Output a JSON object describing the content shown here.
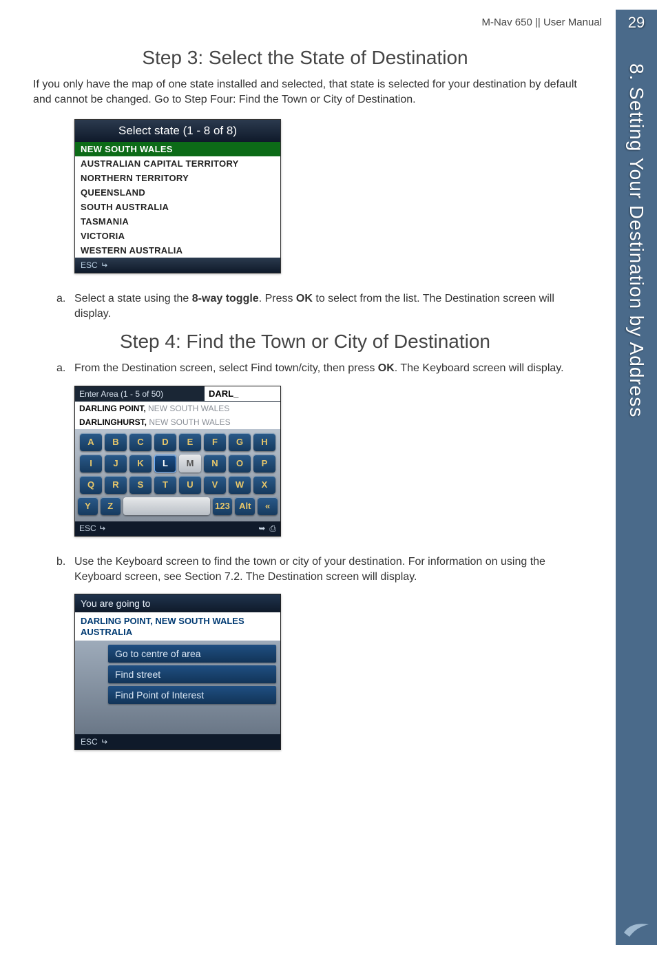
{
  "header": {
    "doc_title": "M-Nav 650 || User Manual"
  },
  "page_number": "29",
  "side_tab": "8. Setting Your Destination by Address",
  "step3": {
    "heading": "Step 3: Select the State of Destination",
    "intro": "If you only have the map of one state installed and selected, that state is selected for your destination by default and cannot be changed. Go to Step Four: Find the Town or City of Destination.",
    "shot": {
      "title": "Select state (1 - 8 of 8)",
      "states": [
        "NEW SOUTH WALES",
        "AUSTRALIAN CAPITAL TERRITORY",
        "NORTHERN TERRITORY",
        "QUEENSLAND",
        "SOUTH AUSTRALIA",
        "TASMANIA",
        "VICTORIA",
        "WESTERN AUSTRALIA"
      ],
      "esc": "ESC"
    },
    "item_a_pre": "Select a state using the ",
    "item_a_bold1": "8-way toggle",
    "item_a_mid": ". Press ",
    "item_a_bold2": "OK",
    "item_a_post": " to select from the list. The Destination screen will display."
  },
  "step4": {
    "heading": "Step 4: Find the Town or City of Destination",
    "item_a_pre": "From the Destination screen, select Find town/city, then press ",
    "item_a_bold": "OK",
    "item_a_post": ". The Keyboard screen will display.",
    "kbshot": {
      "top_label": "Enter Area (1 - 5 of 50)",
      "input": "DARL_",
      "suggest1_a": "DARLING POINT, ",
      "suggest1_b": "NEW SOUTH WALES",
      "suggest2_a": "DARLINGHURST, ",
      "suggest2_b": "NEW SOUTH WALES",
      "rows": [
        [
          "A",
          "B",
          "C",
          "D",
          "E",
          "F",
          "G",
          "H"
        ],
        [
          "I",
          "J",
          "K",
          "L",
          "M",
          "N",
          "O",
          "P"
        ],
        [
          "Q",
          "R",
          "S",
          "T",
          "U",
          "V",
          "W",
          "X"
        ]
      ],
      "row4": {
        "y": "Y",
        "z": "Z",
        "space": " ",
        "num": "123",
        "alt": "Alt",
        "back": "«"
      },
      "esc": "ESC"
    },
    "item_b": "Use the Keyboard screen to find the town or city of your destination. For information on using the Keyboard screen, see Section 7.2. The Destination screen will display.",
    "destshot": {
      "title": "You are going to",
      "addr_line1": "DARLING POINT, NEW SOUTH WALES",
      "addr_line2": "AUSTRALIA",
      "opts": [
        "Go to centre of area",
        "Find street",
        "Find Point of Interest"
      ],
      "esc": "ESC"
    }
  }
}
